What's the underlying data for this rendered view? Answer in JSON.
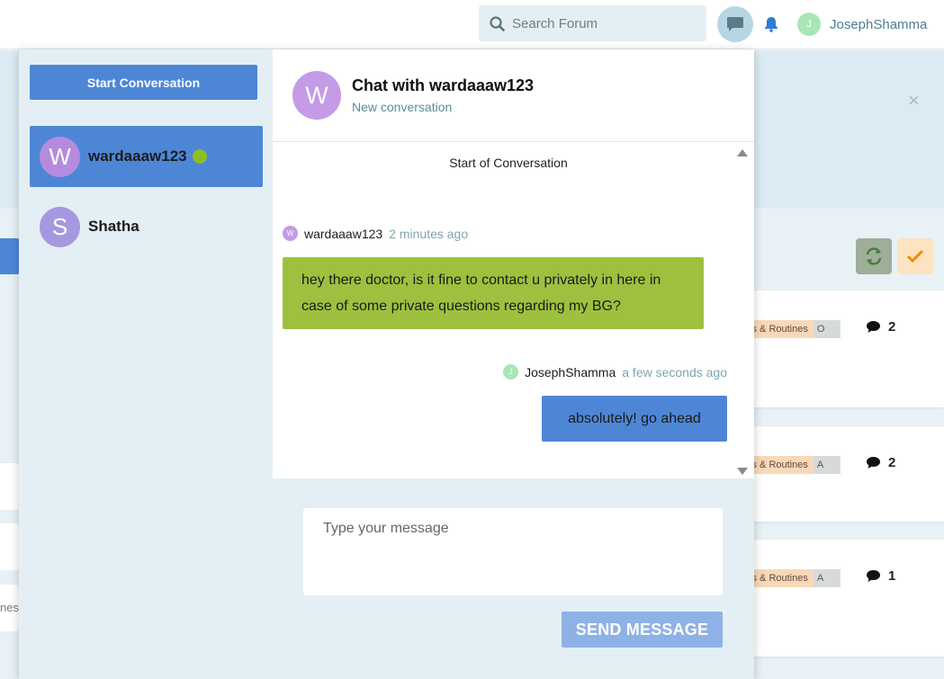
{
  "navbar": {
    "search_placeholder": "Search Forum",
    "user_initial": "J",
    "user_name": "JosephShamma"
  },
  "background": {
    "left_text": "nes",
    "cards": [
      {
        "tag": "ks & Routines",
        "tag2": "O",
        "comments": "2"
      },
      {
        "tag": "ks & Routines",
        "tag2": "A",
        "comments": "2"
      },
      {
        "tag": "ks & Routines",
        "tag2": "A",
        "comments": "1"
      }
    ],
    "close_glyph": "×"
  },
  "sidebar": {
    "start_button": "Start Conversation",
    "conversations": [
      {
        "initial": "W",
        "name": "wardaaaw123",
        "online": true
      },
      {
        "initial": "S",
        "name": "Shatha",
        "online": false
      }
    ]
  },
  "chat": {
    "avatar_initial": "W",
    "title": "Chat with wardaaaw123",
    "subtitle": "New conversation",
    "start_label": "Start of Conversation",
    "messages": [
      {
        "initial": "W",
        "author": "wardaaaw123",
        "time": "2 minutes ago",
        "text": "hey there doctor, is it fine to contact u privately in here in case of some private questions regarding my BG?"
      },
      {
        "initial": "J",
        "author": "JosephShamma",
        "time": "a few seconds ago",
        "text": "absolutely! go ahead"
      }
    ],
    "input_placeholder": "Type your message",
    "send_button": "SEND MESSAGE"
  },
  "colors": {
    "accent": "#4e86d6",
    "incoming_bubble": "#9dc13e",
    "online": "#8cc020",
    "sidebar_bg": "#e3eff4"
  }
}
